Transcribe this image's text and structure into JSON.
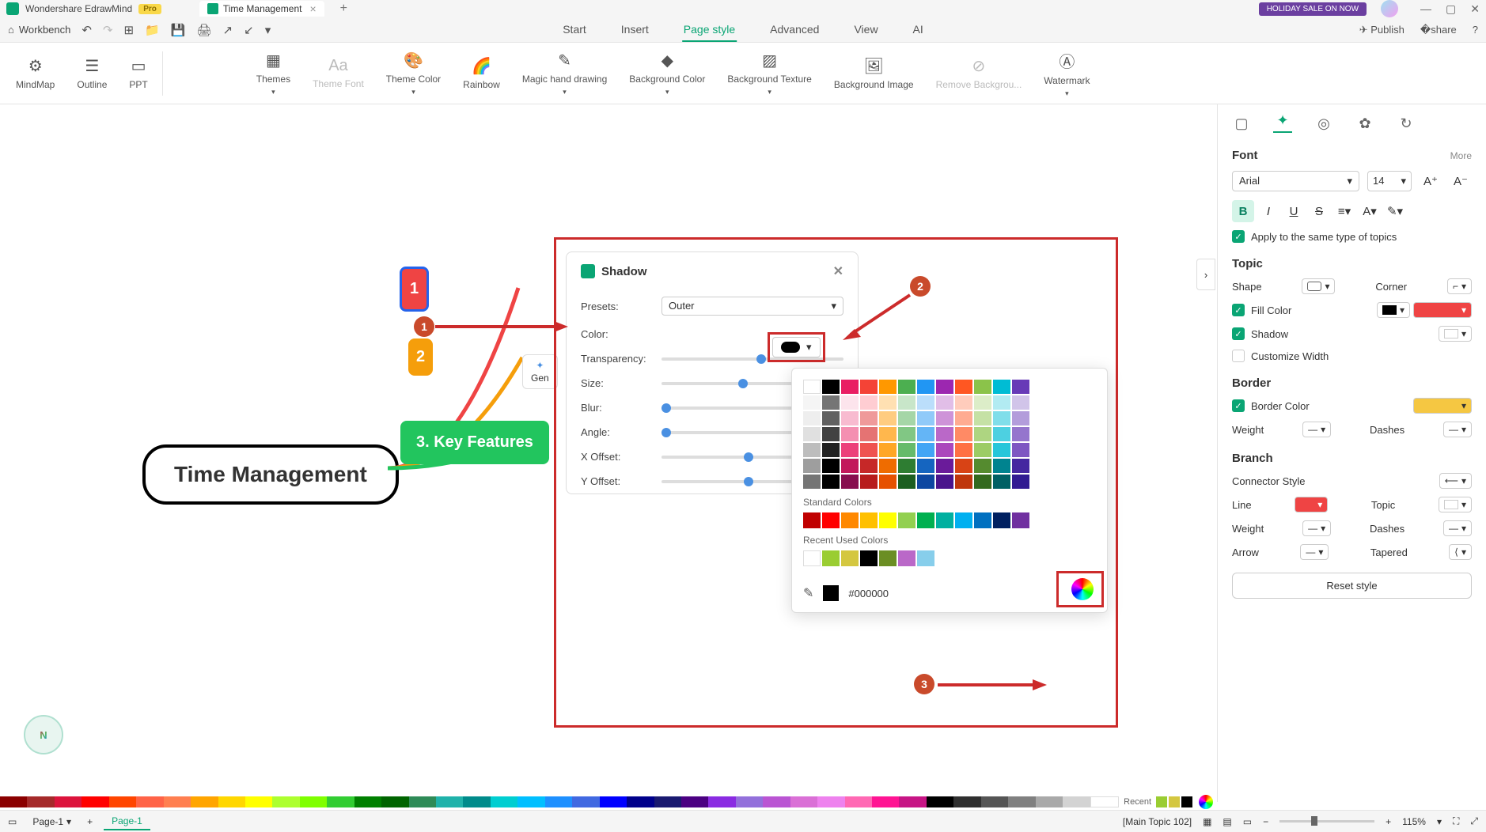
{
  "app": {
    "name": "Wondershare EdrawMind",
    "badge": "Pro",
    "tab": "Time Management",
    "holiday": "HOLIDAY SALE ON NOW"
  },
  "workbench": "Workbench",
  "menu": {
    "start": "Start",
    "insert": "Insert",
    "pagestyle": "Page style",
    "advanced": "Advanced",
    "view": "View",
    "ai": "AI"
  },
  "publish": "Publish",
  "share": "share",
  "ribbon": {
    "mindmap": "MindMap",
    "outline": "Outline",
    "ppt": "PPT",
    "themes": "Themes",
    "themefont": "Theme Font",
    "themecolor": "Theme Color",
    "rainbow": "Rainbow",
    "magic": "Magic hand drawing",
    "bgcolor": "Background Color",
    "bgtexture": "Background Texture",
    "bgimage": "Background Image",
    "removebg": "Remove Backgrou...",
    "watermark": "Watermark"
  },
  "mindmap": {
    "central": "Time Management",
    "sub1": "1",
    "sub2": "2",
    "sub3": "3. Key Features",
    "gen": "Gen"
  },
  "popup": {
    "title": "Shadow",
    "presets": "Presets:",
    "presets_val": "Outer",
    "color": "Color:",
    "transparency": "Transparency:",
    "size": "Size:",
    "blur": "Blur:",
    "angle": "Angle:",
    "xoffset": "X Offset:",
    "yoffset": "Y Offset:"
  },
  "colorpicker": {
    "standard": "Standard Colors",
    "recent": "Recent Used Colors",
    "hex": "#000000"
  },
  "panel": {
    "font": {
      "title": "Font",
      "more": "More",
      "family": "Arial",
      "size": "14",
      "apply": "Apply to the same type of topics"
    },
    "topic": {
      "title": "Topic",
      "shape": "Shape",
      "corner": "Corner",
      "fillcolor": "Fill Color",
      "shadow": "Shadow",
      "customwidth": "Customize Width"
    },
    "border": {
      "title": "Border",
      "bordercolor": "Border Color",
      "weight": "Weight",
      "dashes": "Dashes"
    },
    "branch": {
      "title": "Branch",
      "connector": "Connector Style",
      "line": "Line",
      "topic": "Topic",
      "weight": "Weight",
      "dashes": "Dashes",
      "arrow": "Arrow",
      "tapered": "Tapered"
    },
    "reset": "Reset style"
  },
  "status": {
    "page1": "Page-1",
    "page1b": "Page-1",
    "maintopic": "[Main Topic 102]",
    "zoom": "115%"
  },
  "bottom": {
    "recent": "Recent"
  },
  "callouts": {
    "c1": "1",
    "c2": "2",
    "c3": "3"
  }
}
